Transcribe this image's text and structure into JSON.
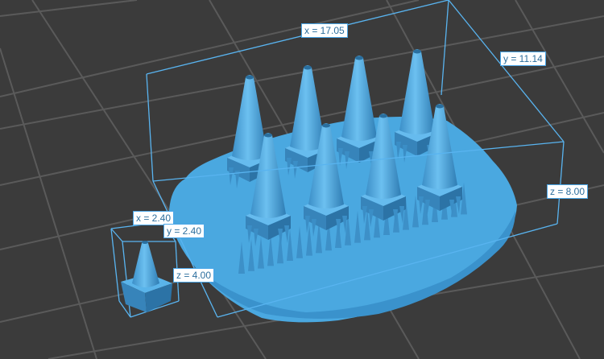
{
  "scene": {
    "background_color": "#3b3b3b",
    "grid_color": "#5a5a5a",
    "model_color": "#4aa8e0",
    "bbox_color": "#59b4f0"
  },
  "large_model": {
    "dim_x": "x = 17.05",
    "dim_y": "y = 11.14",
    "dim_z": "z = 8.00"
  },
  "small_model": {
    "dim_x": "x = 2.40",
    "dim_y": "y = 2.40",
    "dim_z": "z = 4.00"
  }
}
